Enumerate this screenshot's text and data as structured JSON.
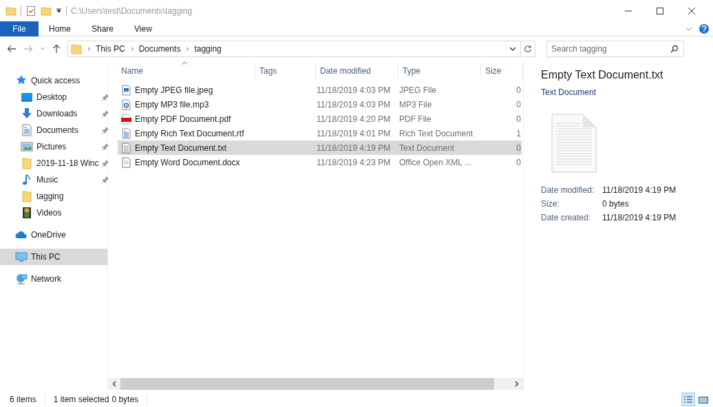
{
  "title_bar": {
    "path": "C:\\Users\\test\\Documents\\tagging"
  },
  "ribbon_tabs": [
    {
      "label": "File",
      "kind": "file",
      "selected": false
    },
    {
      "label": "Home",
      "kind": "tab",
      "selected": false
    },
    {
      "label": "Share",
      "kind": "tab",
      "selected": false
    },
    {
      "label": "View",
      "kind": "tab",
      "selected": false
    }
  ],
  "address_bar": {
    "breadcrumbs": [
      "This PC",
      "Documents",
      "tagging"
    ]
  },
  "search": {
    "placeholder": "Search tagging"
  },
  "nav_pane": [
    {
      "label": "Quick access",
      "kind": "star",
      "selected": false,
      "children": [
        {
          "label": "Desktop",
          "kind": "desktop",
          "pinned": true,
          "selected": false
        },
        {
          "label": "Downloads",
          "kind": "download",
          "pinned": true,
          "selected": false
        },
        {
          "label": "Documents",
          "kind": "documents",
          "pinned": true,
          "selected": false
        },
        {
          "label": "Pictures",
          "kind": "pictures",
          "pinned": true,
          "selected": false
        },
        {
          "label": "2019-11-18 Winc",
          "kind": "folder",
          "pinned": true,
          "selected": false
        },
        {
          "label": "Music",
          "kind": "music",
          "pinned": true,
          "selected": false
        },
        {
          "label": "tagging",
          "kind": "folder",
          "pinned": false,
          "selected": false
        },
        {
          "label": "Videos",
          "kind": "videos",
          "pinned": false,
          "selected": false
        }
      ]
    },
    {
      "label": "OneDrive",
      "kind": "cloud",
      "selected": false
    },
    {
      "label": "This PC",
      "kind": "pc",
      "selected": true
    },
    {
      "label": "Network",
      "kind": "network",
      "selected": false
    }
  ],
  "table": {
    "columns": [
      {
        "label": "Name",
        "sorted": true
      },
      {
        "label": "Tags",
        "sorted": false
      },
      {
        "label": "Date modified",
        "sorted": false
      },
      {
        "label": "Type",
        "sorted": false
      },
      {
        "label": "Size",
        "sorted": false
      }
    ],
    "rows": [
      {
        "name": "Empty JPEG file.jpeg",
        "kind": "jpeg",
        "date": "11/18/2019 4:03 PM",
        "type": "JPEG File",
        "size": "0",
        "selected": false
      },
      {
        "name": "Empty MP3 file.mp3",
        "kind": "mp3",
        "date": "11/18/2019 4:03 PM",
        "type": "MP3 File",
        "size": "0",
        "selected": false
      },
      {
        "name": "Empty PDF Document.pdf",
        "kind": "pdf",
        "date": "11/18/2019 4:20 PM",
        "type": "PDF File",
        "size": "0",
        "selected": false
      },
      {
        "name": "Empty Rich Text Document.rtf",
        "kind": "rtf",
        "date": "11/18/2019 4:01 PM",
        "type": "Rich Text Document",
        "size": "1",
        "selected": false
      },
      {
        "name": "Empty Text Document.txt",
        "kind": "txt",
        "date": "11/18/2019 4:19 PM",
        "type": "Text Document",
        "size": "0",
        "selected": true
      },
      {
        "name": "Empty Word Document.docx",
        "kind": "docx",
        "date": "11/18/2019 4:23 PM",
        "type": "Office Open XML ...",
        "size": "0",
        "selected": false
      }
    ]
  },
  "details_pane": {
    "title": "Empty Text Document.txt",
    "type": "Text Document",
    "fields": [
      {
        "label": "Date modified:",
        "value": "11/18/2019 4:19 PM"
      },
      {
        "label": "Size:",
        "value": "0 bytes"
      },
      {
        "label": "Date created:",
        "value": "11/18/2019 4:19 PM"
      }
    ]
  },
  "status_bar": {
    "item_count": "6 items",
    "selection": "1 item selected",
    "selection_size": "0 bytes"
  },
  "view_buttons": [
    {
      "kind": "details",
      "selected": true
    },
    {
      "kind": "large-icons",
      "selected": false
    }
  ]
}
